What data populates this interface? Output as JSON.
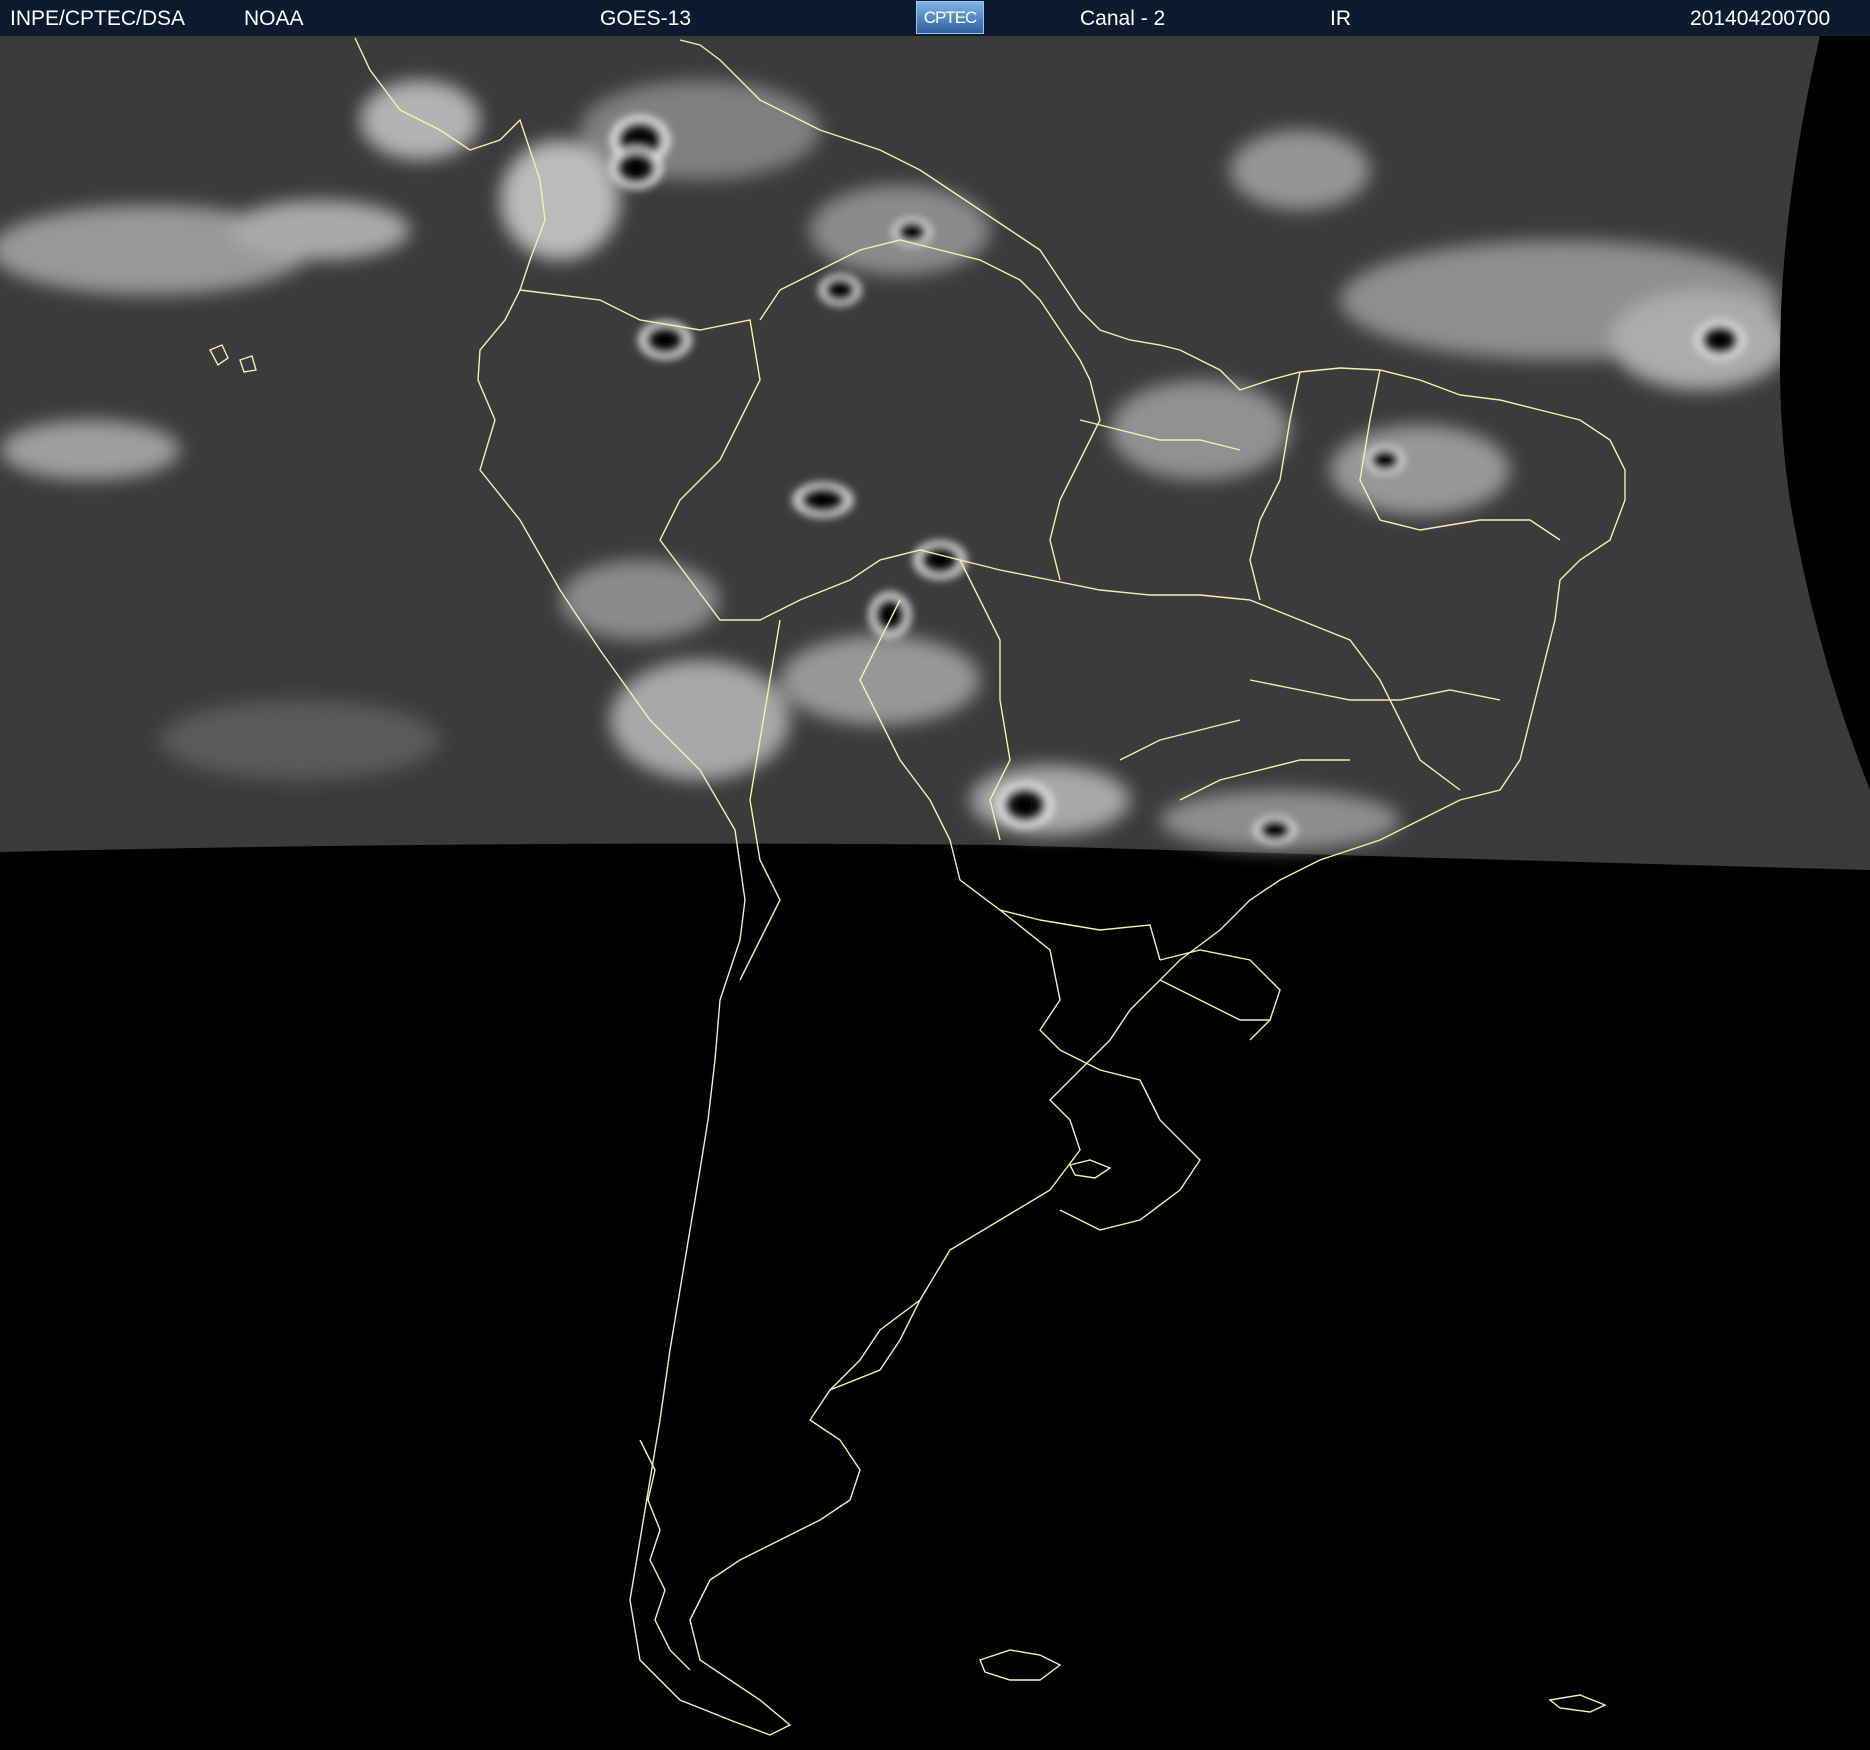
{
  "header": {
    "org": "INPE/CPTEC/DSA",
    "agency": "NOAA",
    "satellite": "GOES-13",
    "logo_text": "CPTEC",
    "channel": "Canal - 2",
    "band": "IR",
    "timestamp": "201404200700"
  },
  "colors": {
    "header_bg": "#0b1a2e",
    "coastline": "#f4f1b0",
    "cloud_bright": "#ffffff",
    "background": "#000000"
  }
}
